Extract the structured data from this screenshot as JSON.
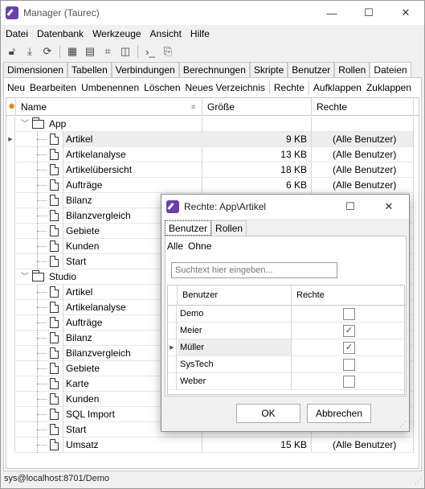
{
  "window": {
    "title": "Manager (Taurec)",
    "minimize": "—",
    "maximize": "☐",
    "close": "✕"
  },
  "menu": [
    "Datei",
    "Datenbank",
    "Werkzeuge",
    "Ansicht",
    "Hilfe"
  ],
  "toolbar_icons": [
    "lock-icon",
    "download-icon",
    "refresh-icon",
    "grid-icon",
    "table-icon",
    "tree-icon",
    "columns-icon",
    "terminal-icon",
    "export-icon"
  ],
  "tabs": [
    "Dimensionen",
    "Tabellen",
    "Verbindungen",
    "Berechnungen",
    "Skripte",
    "Benutzer",
    "Rollen",
    "Dateien"
  ],
  "active_tab": "Dateien",
  "actions": [
    "Neu",
    "Bearbeiten",
    "Umbenennen",
    "Löschen",
    "Neues Verzeichnis",
    "Rechte",
    "Aufklappen",
    "Zuklappen"
  ],
  "grid": {
    "columns": {
      "name": "Name",
      "size": "Größe",
      "rights": "Rechte"
    },
    "rows": [
      {
        "type": "folder",
        "name": "App",
        "size": "",
        "rights": ""
      },
      {
        "type": "file",
        "name": "Artikel",
        "size": "9 KB",
        "rights": "(Alle Benutzer)",
        "selected": true
      },
      {
        "type": "file",
        "name": "Artikelanalyse",
        "size": "13 KB",
        "rights": "(Alle Benutzer)"
      },
      {
        "type": "file",
        "name": "Artikelübersicht",
        "size": "18 KB",
        "rights": "(Alle Benutzer)"
      },
      {
        "type": "file",
        "name": "Aufträge",
        "size": "6 KB",
        "rights": "(Alle Benutzer)"
      },
      {
        "type": "file",
        "name": "Bilanz",
        "size": "",
        "rights": ""
      },
      {
        "type": "file",
        "name": "Bilanzvergleich",
        "size": "",
        "rights": ""
      },
      {
        "type": "file",
        "name": "Gebiete",
        "size": "",
        "rights": ""
      },
      {
        "type": "file",
        "name": "Kunden",
        "size": "",
        "rights": ""
      },
      {
        "type": "file",
        "name": "Start",
        "size": "",
        "rights": ""
      },
      {
        "type": "folder",
        "name": "Studio",
        "size": "",
        "rights": ""
      },
      {
        "type": "file",
        "name": "Artikel",
        "size": "",
        "rights": ""
      },
      {
        "type": "file",
        "name": "Artikelanalyse",
        "size": "",
        "rights": ""
      },
      {
        "type": "file",
        "name": "Aufträge",
        "size": "",
        "rights": ""
      },
      {
        "type": "file",
        "name": "Bilanz",
        "size": "",
        "rights": ""
      },
      {
        "type": "file",
        "name": "Bilanzvergleich",
        "size": "",
        "rights": ""
      },
      {
        "type": "file",
        "name": "Gebiete",
        "size": "",
        "rights": ""
      },
      {
        "type": "file",
        "name": "Karte",
        "size": "",
        "rights": ""
      },
      {
        "type": "file",
        "name": "Kunden",
        "size": "",
        "rights": ""
      },
      {
        "type": "file",
        "name": "SQL Import",
        "size": "",
        "rights": ""
      },
      {
        "type": "file",
        "name": "Start",
        "size": "",
        "rights": ""
      },
      {
        "type": "file",
        "name": "Umsatz",
        "size": "15 KB",
        "rights": "(Alle Benutzer)"
      }
    ]
  },
  "status": "sys@localhost:8701/Demo",
  "dialog": {
    "title": "Rechte: App\\Artikel",
    "tabs": [
      "Benutzer",
      "Rollen"
    ],
    "links": [
      "Alle",
      "Ohne"
    ],
    "search_placeholder": "Suchtext hier eingeben...",
    "columns": {
      "user": "Benutzer",
      "rights": "Rechte"
    },
    "users": [
      {
        "name": "Demo",
        "checked": false
      },
      {
        "name": "Meier",
        "checked": true
      },
      {
        "name": "Müller",
        "checked": true,
        "selected": true
      },
      {
        "name": "SysTech",
        "checked": false
      },
      {
        "name": "Weber",
        "checked": false
      }
    ],
    "ok": "OK",
    "cancel": "Abbrechen"
  }
}
